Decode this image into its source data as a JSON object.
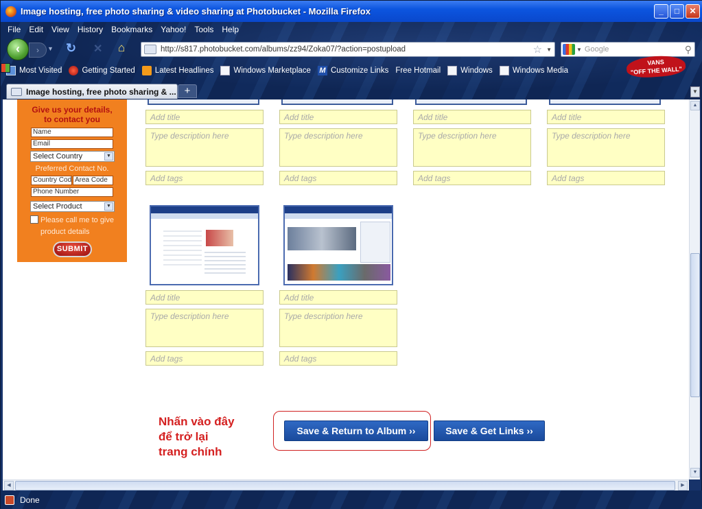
{
  "window": {
    "title": "Image hosting, free photo sharing & video sharing at Photobucket - Mozilla Firefox"
  },
  "menu": [
    "File",
    "Edit",
    "View",
    "History",
    "Bookmarks",
    "Yahoo!",
    "Tools",
    "Help"
  ],
  "address": {
    "url": "http://s817.photobucket.com/albums/zz94/Zoka07/?action=postupload"
  },
  "search": {
    "placeholder": "Google"
  },
  "bookmarks": [
    {
      "label": "Most Visited",
      "icon": "most-visited-icon"
    },
    {
      "label": "Getting Started",
      "icon": "getting-started-icon"
    },
    {
      "label": "Latest Headlines",
      "icon": "rss-icon"
    },
    {
      "label": "Windows Marketplace",
      "icon": "page-icon"
    },
    {
      "label": "Customize Links",
      "icon": "msn-icon"
    },
    {
      "label": "Free Hotmail",
      "icon": "windows-flag-icon"
    },
    {
      "label": "Windows",
      "icon": "page-icon"
    },
    {
      "label": "Windows Media",
      "icon": "page-icon"
    }
  ],
  "brand": {
    "line1": "VANS",
    "line2": "\"OFF THE WALL\""
  },
  "tab": {
    "label": "Image hosting, free photo sharing & ...",
    "new_tab": "+"
  },
  "status": {
    "text": "Done"
  },
  "contact_form": {
    "heading_line1": "Give us your details,",
    "heading_line2": "to contact you",
    "name_placeholder": "Name",
    "email_placeholder": "Email",
    "country_select": "Select Country",
    "preferred_label": "Preferred Contact No.",
    "country_code_placeholder": "Country Code",
    "area_code_placeholder": "Area Code",
    "phone_placeholder": "Phone Number",
    "product_select": "Select Product",
    "callback_label": "Please call me to give product details",
    "submit_label": "SUBMIT"
  },
  "uploads": {
    "title_placeholder": "Add title",
    "desc_placeholder": "Type description here",
    "tags_placeholder": "Add tags"
  },
  "annotation": {
    "line1": "Nhấn vào đây",
    "line2": "để trở lại",
    "line3": "trang chính"
  },
  "actions": {
    "save_return": "Save & Return to Album ››",
    "save_links": "Save & Get Links ››"
  },
  "colors": {
    "form_bg": "#f1801f",
    "field_bg": "#ffffc4",
    "button_blue": "#1f55ad",
    "annotation_red": "#d42020"
  }
}
